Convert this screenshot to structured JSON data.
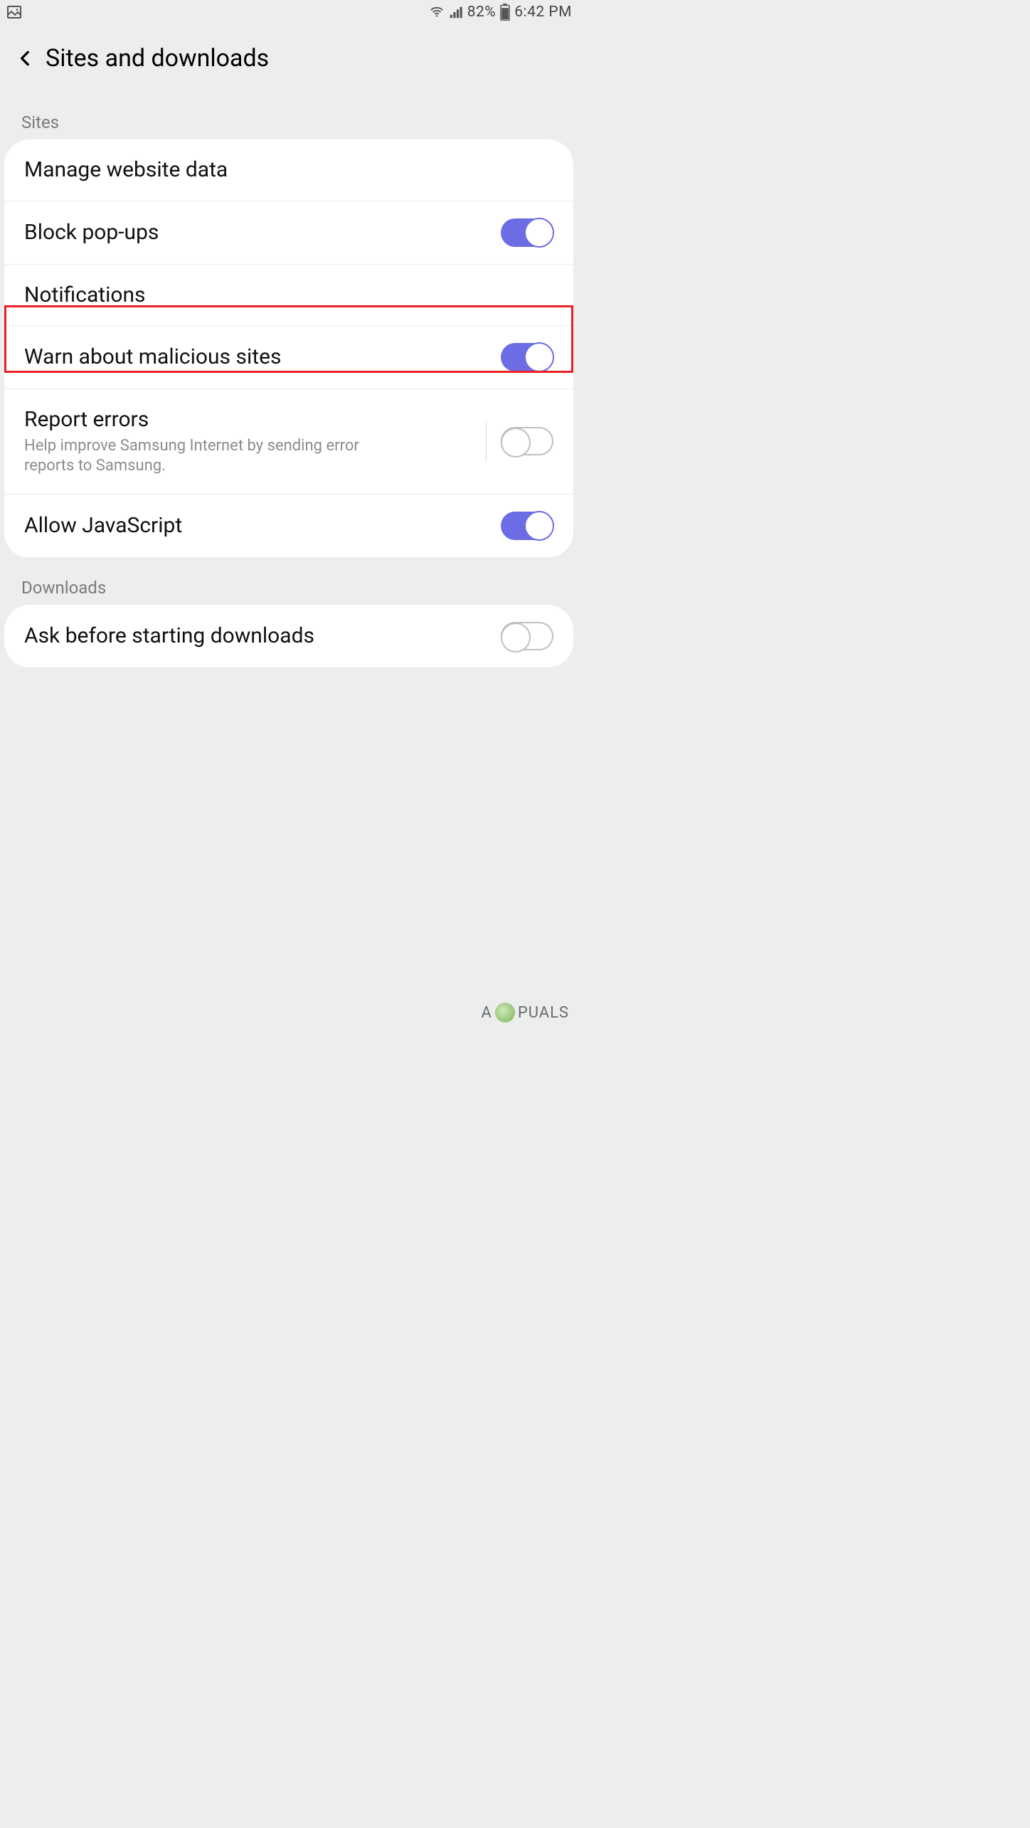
{
  "status": {
    "battery_pct": "82%",
    "time": "6:42 PM"
  },
  "header": {
    "title": "Sites and downloads"
  },
  "sections": {
    "sites_label": "Sites",
    "downloads_label": "Downloads"
  },
  "rows": {
    "manage_website_data": "Manage website data",
    "block_popups": "Block pop-ups",
    "notifications": "Notifications",
    "warn_malicious": "Warn about malicious sites",
    "report_errors_title": "Report errors",
    "report_errors_sub": "Help improve Samsung Internet by sending error reports to Samsung.",
    "allow_js": "Allow JavaScript",
    "ask_before_download": "Ask before starting downloads"
  },
  "toggles": {
    "block_popups": true,
    "warn_malicious": true,
    "report_errors": false,
    "allow_js": true,
    "ask_before_download": false
  },
  "watermark": {
    "text_left": "A",
    "text_right": "PUALS"
  }
}
